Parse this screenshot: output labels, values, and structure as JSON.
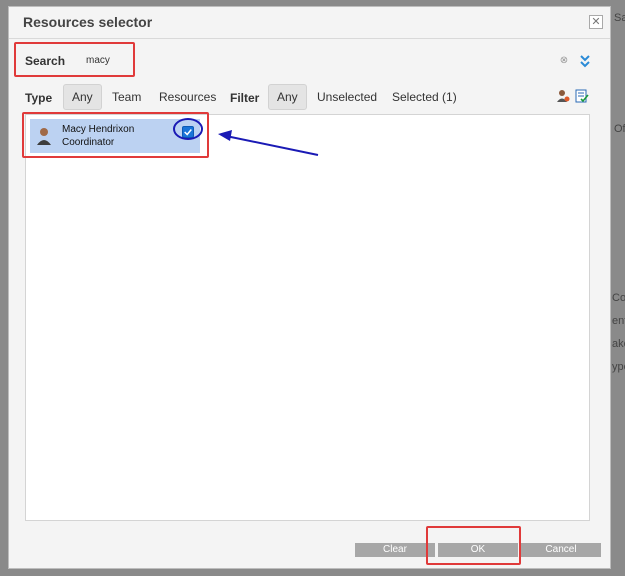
{
  "background": {
    "fragments": [
      "Sav",
      "Off",
      "Co",
      "ent",
      "ake",
      "ype"
    ]
  },
  "dialog": {
    "title": "Resources selector",
    "close_label": "✕"
  },
  "search": {
    "label": "Search",
    "value": "macy"
  },
  "filters": {
    "type_label": "Type",
    "type_options": [
      "Any",
      "Team",
      "Resources"
    ],
    "type_selected": "Any",
    "filter_label": "Filter",
    "filter_options": [
      "Any",
      "Unselected",
      "Selected (1)"
    ],
    "filter_selected": "Any"
  },
  "icons": {
    "clear_search": "clear-search-icon",
    "expand": "double-chevron-down-icon",
    "person_filter": "person-filter-icon",
    "selected_filter": "selected-list-icon"
  },
  "results": [
    {
      "name": "Macy Hendrixon",
      "role": "Coordinator",
      "checked": true
    }
  ],
  "buttons": {
    "clear": "Clear",
    "ok": "OK",
    "cancel": "Cancel"
  },
  "colors": {
    "annotation_red": "#e03a3a",
    "annotation_blue": "#1a1ab5",
    "selected_row": "#bcd2f2",
    "checkbox": "#1a74d8"
  }
}
